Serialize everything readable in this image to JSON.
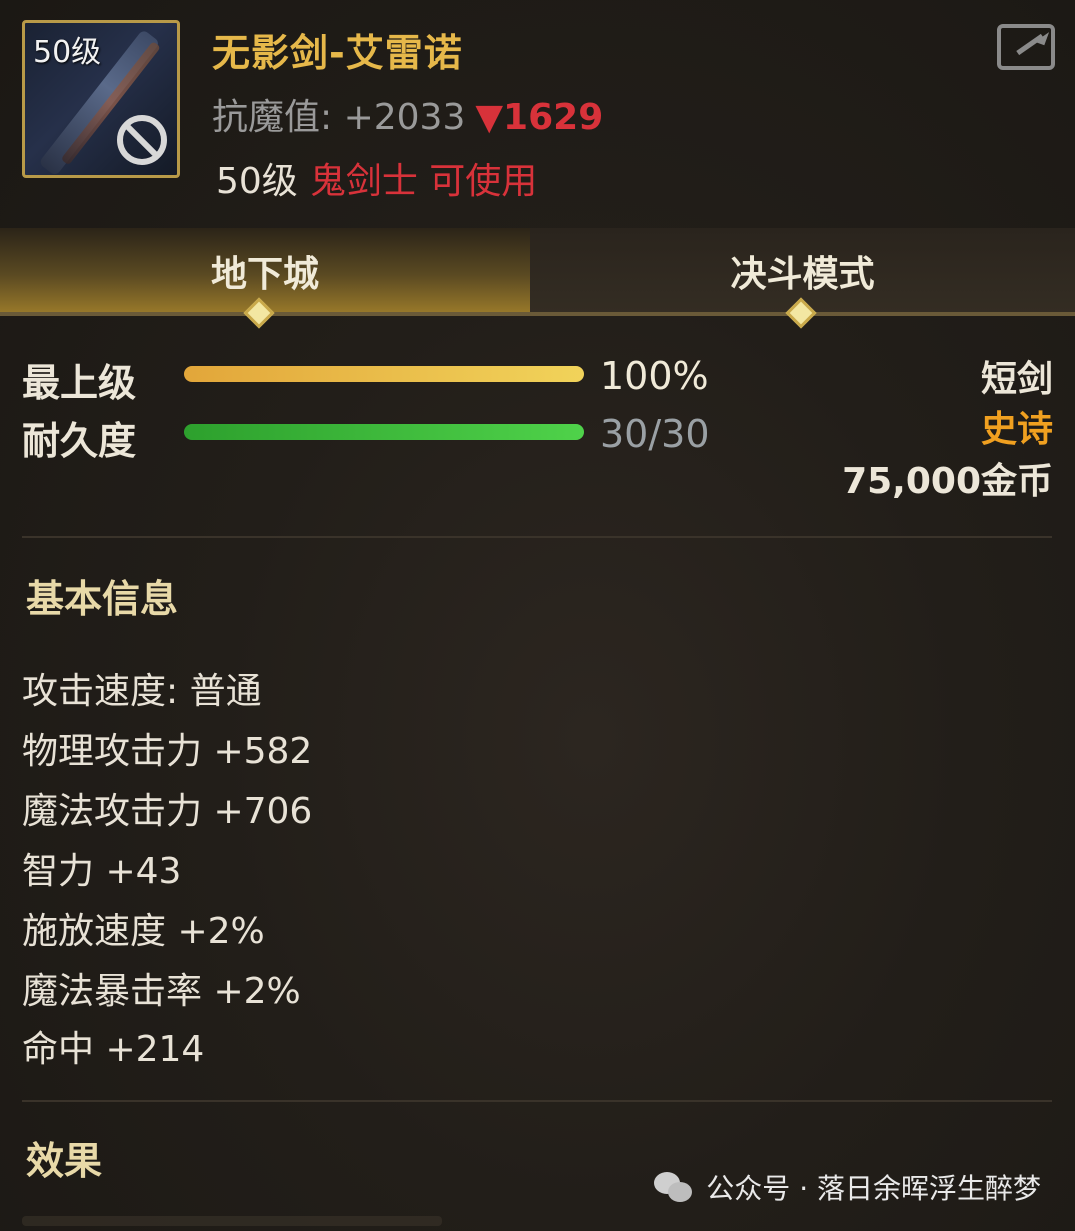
{
  "item": {
    "level_badge": "50级",
    "name": "无影剑-艾雷诺",
    "resist_label": "抗魔值: +2033",
    "resist_diff": "▼1629",
    "req_level": "50级",
    "req_class": "鬼剑士 可使用"
  },
  "tabs": [
    {
      "label": "地下城",
      "active": true
    },
    {
      "label": "决斗模式",
      "active": false
    }
  ],
  "stats": {
    "grade": {
      "label": "最上级",
      "value": "100%",
      "fill": 1.0
    },
    "durability": {
      "label": "耐久度",
      "value": "30/30",
      "fill": 1.0
    }
  },
  "right_info": {
    "weapon_type": "短剑",
    "rarity": "史诗",
    "price": "75,000金币"
  },
  "sections": {
    "basic": "基本信息",
    "effect": "效果"
  },
  "attributes": [
    "攻击速度: 普通",
    "物理攻击力 +582",
    "魔法攻击力 +706",
    "智力 +43",
    "施放速度 +2%",
    "魔法暴击率 +2%",
    "命中 +214"
  ],
  "watermark": "公众号 · 落日余晖浮生醉梦",
  "colors": {
    "gold": "#e6b84a",
    "red": "#d8323a",
    "rarity": "#f0a020"
  }
}
